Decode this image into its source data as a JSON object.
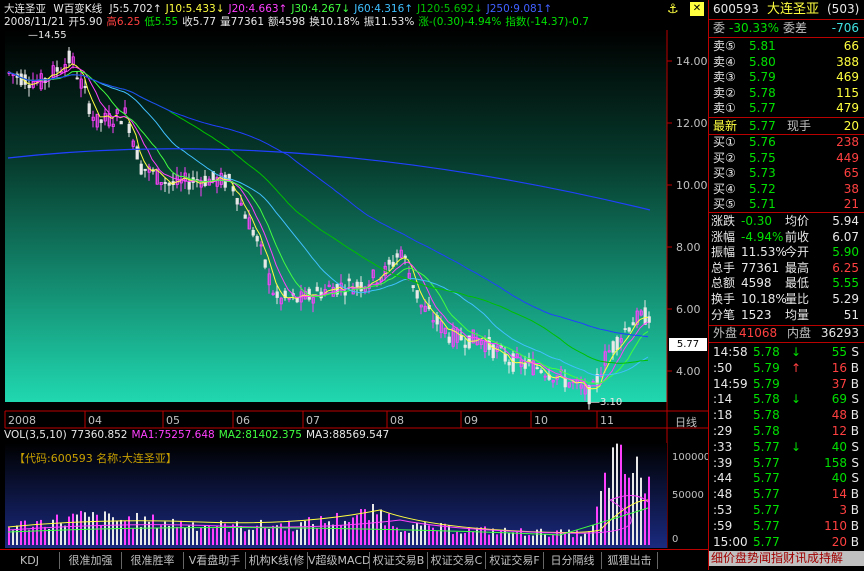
{
  "header": {
    "stock_name": "大连圣亚",
    "period": "W百变K线",
    "ma": [
      {
        "label": "J5:5.702",
        "color": "#e8e8e8"
      },
      {
        "label": "J10:5.433",
        "color": "#ffff40"
      },
      {
        "label": "J20:4.663",
        "color": "#ff40ff"
      },
      {
        "label": "J30:4.267",
        "color": "#40ff40"
      },
      {
        "label": "J60:4.316",
        "color": "#40c0ff"
      },
      {
        "label": "J120:5.692",
        "color": "#00c000"
      },
      {
        "label": "J250:9.081",
        "color": "#4060ff"
      }
    ],
    "line2": {
      "date": "2008/11/21",
      "open": "开5.90",
      "high": "高6.25",
      "low": "低5.55",
      "close": "收5.77",
      "vol": "量77361",
      "amount": "额4598",
      "turnover": "换10.18%",
      "amp": "振11.53%",
      "change": "涨-(0.30)-4.94%",
      "index": "指数(-14.37)-0.7"
    }
  },
  "price_axis": [
    "14.00",
    "12.00",
    "10.00",
    "8.00",
    "6.00",
    "4.00"
  ],
  "price_marker": "5.77",
  "high_label": "14.55",
  "low_label": "3.10",
  "x_axis": [
    "2008",
    "04",
    "05",
    "06",
    "07",
    "08",
    "09",
    "10",
    "11"
  ],
  "period_label": "日线",
  "vol_header": {
    "name": "VOL(3,5,10)",
    "vol": "77360.852",
    "ma1": "MA1:75257.648",
    "ma2": "MA2:81402.375",
    "ma3": "MA3:88569.547"
  },
  "vol_info": "【代码:600593 名称:大连圣亚】",
  "vol_axis": [
    "100000",
    "50000",
    "0"
  ],
  "tabs": [
    "KDJ",
    "很准加强",
    "很准胜率",
    "V看盘助手",
    "机构K线(修",
    "V超级MACD",
    "权证交易B",
    "权证交易C",
    "权证交易F",
    "日分隔线",
    "狐狸出击"
  ],
  "right": {
    "code": "600593",
    "name": "大连圣亚",
    "num": "(503)",
    "weibi_label": "委",
    "weibi": "-30.33%",
    "weicha_label": "委差",
    "weicha": "-706",
    "asks": [
      {
        "label": "卖⑤",
        "price": "5.81",
        "vol": "66"
      },
      {
        "label": "卖④",
        "price": "5.80",
        "vol": "388"
      },
      {
        "label": "卖③",
        "price": "5.79",
        "vol": "469"
      },
      {
        "label": "卖②",
        "price": "5.78",
        "vol": "115"
      },
      {
        "label": "卖①",
        "price": "5.77",
        "vol": "479"
      }
    ],
    "latest_label": "最新",
    "latest": "5.77",
    "xianshou_label": "现手",
    "xianshou": "20",
    "bids": [
      {
        "label": "买①",
        "price": "5.76",
        "vol": "238"
      },
      {
        "label": "买②",
        "price": "5.75",
        "vol": "449"
      },
      {
        "label": "买③",
        "price": "5.73",
        "vol": "65"
      },
      {
        "label": "买④",
        "price": "5.72",
        "vol": "38"
      },
      {
        "label": "买⑤",
        "price": "5.71",
        "vol": "21"
      }
    ],
    "stats": [
      {
        "l1": "涨跌",
        "v1": "-0.30",
        "l2": "均价",
        "v2": "5.94"
      },
      {
        "l1": "涨幅",
        "v1": "-4.94%",
        "l2": "前收",
        "v2": "6.07"
      },
      {
        "l1": "振幅",
        "v1": "11.53%",
        "l2": "今开",
        "v2": "5.90"
      },
      {
        "l1": "总手",
        "v1": "77361",
        "l2": "最高",
        "v2": "6.25"
      },
      {
        "l1": "总额",
        "v1": "4598",
        "l2": "最低",
        "v2": "5.55"
      },
      {
        "l1": "换手",
        "v1": "10.18%",
        "l2": "量比",
        "v2": "5.29"
      },
      {
        "l1": "分笔",
        "v1": "1523",
        "l2": "均量",
        "v2": "51"
      }
    ],
    "outer_label": "外盘",
    "outer": "41068",
    "inner_label": "内盘",
    "inner": "36293",
    "ticks": [
      {
        "t": "14:58",
        "p": "5.78",
        "a": "↓",
        "v": "55",
        "s": "S"
      },
      {
        "t": ":50",
        "p": "5.79",
        "a": "↑",
        "v": "16",
        "s": "B"
      },
      {
        "t": "14:59",
        "p": "5.79",
        "a": "",
        "v": "37",
        "s": "B"
      },
      {
        "t": ":14",
        "p": "5.78",
        "a": "↓",
        "v": "69",
        "s": "S"
      },
      {
        "t": ":18",
        "p": "5.78",
        "a": "",
        "v": "48",
        "s": "B"
      },
      {
        "t": ":29",
        "p": "5.78",
        "a": "",
        "v": "12",
        "s": "B"
      },
      {
        "t": ":33",
        "p": "5.77",
        "a": "↓",
        "v": "40",
        "s": "S"
      },
      {
        "t": ":39",
        "p": "5.77",
        "a": "",
        "v": "158",
        "s": "S"
      },
      {
        "t": ":44",
        "p": "5.77",
        "a": "",
        "v": "40",
        "s": "S"
      },
      {
        "t": ":48",
        "p": "5.77",
        "a": "",
        "v": "14",
        "s": "B"
      },
      {
        "t": ":53",
        "p": "5.77",
        "a": "",
        "v": "3",
        "s": "B"
      },
      {
        "t": ":59",
        "p": "5.77",
        "a": "",
        "v": "110",
        "s": "B"
      },
      {
        "t": "15:00",
        "p": "5.77",
        "a": "",
        "v": "20",
        "s": "B"
      }
    ],
    "footer": "细价盘势闻指财讯成持解"
  },
  "colors": {
    "bg": "#000000",
    "up": "#ff40ff",
    "down": "#e8e8e8",
    "grid": "#b00000"
  },
  "chart_data": {
    "type": "candlestick",
    "x": [
      "2008",
      "04",
      "05",
      "06",
      "07",
      "08",
      "09",
      "10",
      "11"
    ],
    "ylim": [
      3.0,
      15.0
    ],
    "high": 14.55,
    "low": 3.1,
    "last": 5.77,
    "volume_ylim": [
      0,
      120000
    ]
  }
}
